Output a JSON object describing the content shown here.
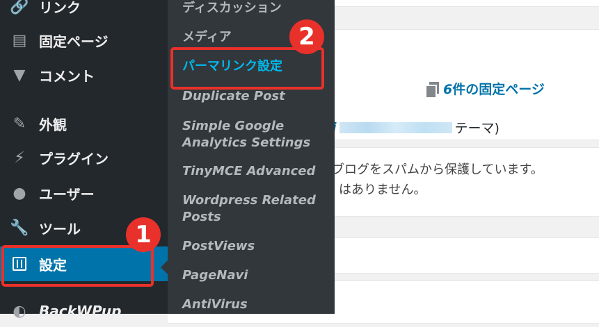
{
  "sidebar": {
    "items": [
      {
        "label": "リンク",
        "icon": "link-icon"
      },
      {
        "label": "固定ページ",
        "icon": "pages-icon"
      },
      {
        "label": "コメント",
        "icon": "comment-icon"
      },
      {
        "label": "外観",
        "icon": "appearance-icon"
      },
      {
        "label": "プラグイン",
        "icon": "plugin-icon"
      },
      {
        "label": "ユーザー",
        "icon": "user-icon"
      },
      {
        "label": "ツール",
        "icon": "wrench-icon"
      },
      {
        "label": "設定",
        "icon": "settings-icon"
      },
      {
        "label": "BackWPup",
        "icon": "backwpup-icon"
      }
    ]
  },
  "submenu": {
    "items": [
      "ディスカッション",
      "メディア",
      "パーマリンク設定",
      "Duplicate Post",
      "Simple Google Analytics Settings",
      "TinyMCE Advanced",
      "Wordpress Related Posts",
      "PostViews",
      "PageNavi",
      "AntiVirus"
    ]
  },
  "dashboard": {
    "pages_count": "6",
    "pages_text": "件の固定ページ",
    "theme_prefix": "i",
    "theme_suffix": "テーマ)",
    "akismet_line1": "ブログをスパムから保護しています。",
    "akismet_line2": "はありません。"
  },
  "callouts": {
    "badge1": "1",
    "badge2": "2"
  },
  "colors": {
    "sidebar_bg": "#23282d",
    "submenu_bg": "#32373c",
    "active_blue": "#0073aa",
    "submenu_active": "#00b9eb",
    "callout_red": "#e8312a"
  }
}
